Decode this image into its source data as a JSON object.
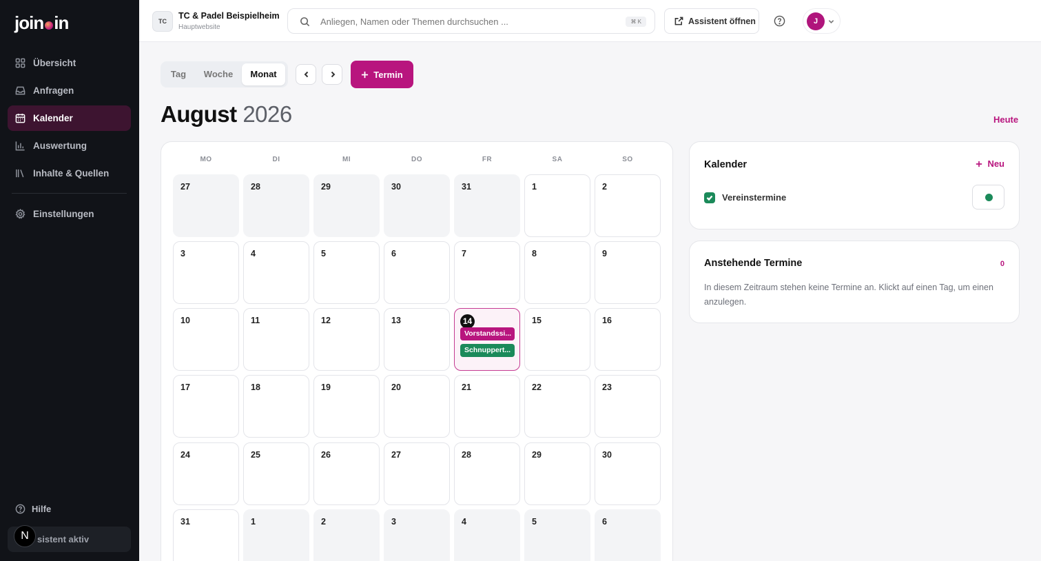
{
  "app": {
    "logo_part1": "join",
    "logo_part2": "in"
  },
  "sidebar": {
    "items": [
      {
        "label": "Übersicht",
        "icon": "grid-icon"
      },
      {
        "label": "Anfragen",
        "icon": "inbox-icon"
      },
      {
        "label": "Kalender",
        "icon": "calendar-icon",
        "active": true
      },
      {
        "label": "Auswertung",
        "icon": "bar-chart-icon"
      },
      {
        "label": "Inhalte & Quellen",
        "icon": "library-icon"
      },
      {
        "label": "Einstellungen",
        "icon": "gear-icon"
      }
    ],
    "help_label": "Hilfe",
    "assistant_status": "sistent aktiv",
    "n_badge": "N"
  },
  "topbar": {
    "org_initials": "TC",
    "org_name": "TC & Padel Beispielheim",
    "org_sub": "Hauptwebsite",
    "search_placeholder": "Anliegen, Namen oder Themen durchsuchen ...",
    "search_shortcut": "⌘ K",
    "assistant_button": "Assistent öffnen",
    "user_initial": "J"
  },
  "view": {
    "tabs": [
      "Tag",
      "Woche",
      "Monat"
    ],
    "active_tab": "Monat",
    "add_button": "Termin",
    "month": "August",
    "year": "2026",
    "today_link": "Heute"
  },
  "calendar": {
    "weekdays": [
      "MO",
      "DI",
      "MI",
      "DO",
      "FR",
      "SA",
      "SO"
    ],
    "weeks": [
      [
        {
          "d": "27",
          "m": true
        },
        {
          "d": "28",
          "m": true
        },
        {
          "d": "29",
          "m": true
        },
        {
          "d": "30",
          "m": true
        },
        {
          "d": "31",
          "m": true
        },
        {
          "d": "1"
        },
        {
          "d": "2"
        }
      ],
      [
        {
          "d": "3"
        },
        {
          "d": "4"
        },
        {
          "d": "5"
        },
        {
          "d": "6"
        },
        {
          "d": "7"
        },
        {
          "d": "8"
        },
        {
          "d": "9"
        }
      ],
      [
        {
          "d": "10"
        },
        {
          "d": "11"
        },
        {
          "d": "12"
        },
        {
          "d": "13"
        },
        {
          "d": "14",
          "today": true
        },
        {
          "d": "15"
        },
        {
          "d": "16"
        }
      ],
      [
        {
          "d": "17"
        },
        {
          "d": "18"
        },
        {
          "d": "19"
        },
        {
          "d": "20"
        },
        {
          "d": "21"
        },
        {
          "d": "22"
        },
        {
          "d": "23"
        }
      ],
      [
        {
          "d": "24"
        },
        {
          "d": "25"
        },
        {
          "d": "26"
        },
        {
          "d": "27"
        },
        {
          "d": "28"
        },
        {
          "d": "29"
        },
        {
          "d": "30"
        }
      ],
      [
        {
          "d": "31"
        },
        {
          "d": "1",
          "m": true
        },
        {
          "d": "2",
          "m": true
        },
        {
          "d": "3",
          "m": true
        },
        {
          "d": "4",
          "m": true
        },
        {
          "d": "5",
          "m": true
        },
        {
          "d": "6",
          "m": true
        }
      ]
    ],
    "events": [
      {
        "day": "14",
        "label": "Vorstandssi...",
        "color": "#b8157e"
      },
      {
        "day": "14",
        "label": "Schnuppert...",
        "color": "#1b8a5a"
      }
    ]
  },
  "calendars_panel": {
    "title": "Kalender",
    "new_label": "Neu",
    "items": [
      {
        "name": "Vereinstermine",
        "checked": true,
        "color": "#1b8a5a"
      }
    ]
  },
  "upcoming_panel": {
    "title": "Anstehende Termine",
    "count": "0",
    "empty_message": "In diesem Zeitraum stehen keine Termine an. Klickt auf einen Tag, um einen anzulegen."
  },
  "colors": {
    "accent": "#b8157e",
    "sidebar_bg": "#111318",
    "sidebar_active": "#3d1430",
    "green": "#1b8a5a"
  }
}
